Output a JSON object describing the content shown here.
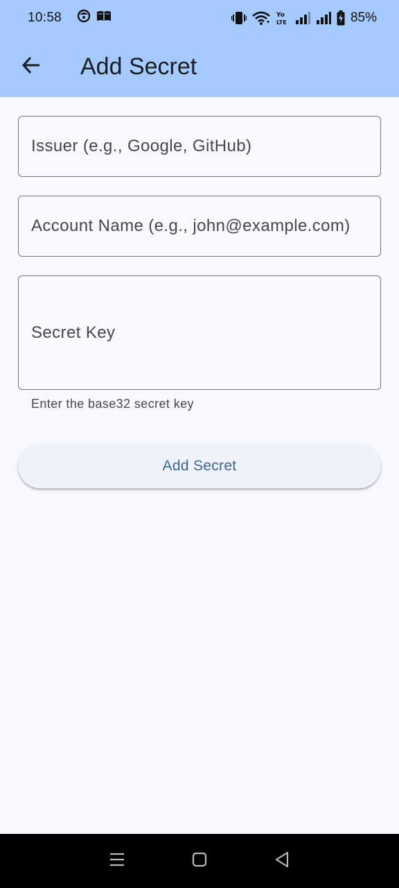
{
  "status_bar": {
    "time": "10:58",
    "battery": "85%",
    "icons": [
      "face-icon",
      "book-icon",
      "vibrate-icon",
      "wifi-icon",
      "volte-icon",
      "signal-icon",
      "signal-icon",
      "battery-charging-icon"
    ]
  },
  "app_bar": {
    "title": "Add Secret",
    "back_icon": "arrow-back-icon"
  },
  "form": {
    "issuer_placeholder": "Issuer (e.g., Google, GitHub)",
    "account_placeholder": "Account Name (e.g., john@example.com)",
    "secret_placeholder": "Secret Key",
    "secret_helper": "Enter the base32 secret key",
    "submit_label": "Add Secret"
  },
  "nav_bar": {
    "icons": [
      "menu-icon",
      "home-icon",
      "back-triangle-icon"
    ]
  },
  "colors": {
    "app_bar": "#a5cbfe",
    "background": "#f7f9ff",
    "button_text": "#3a6593",
    "outline": "#74777f"
  }
}
